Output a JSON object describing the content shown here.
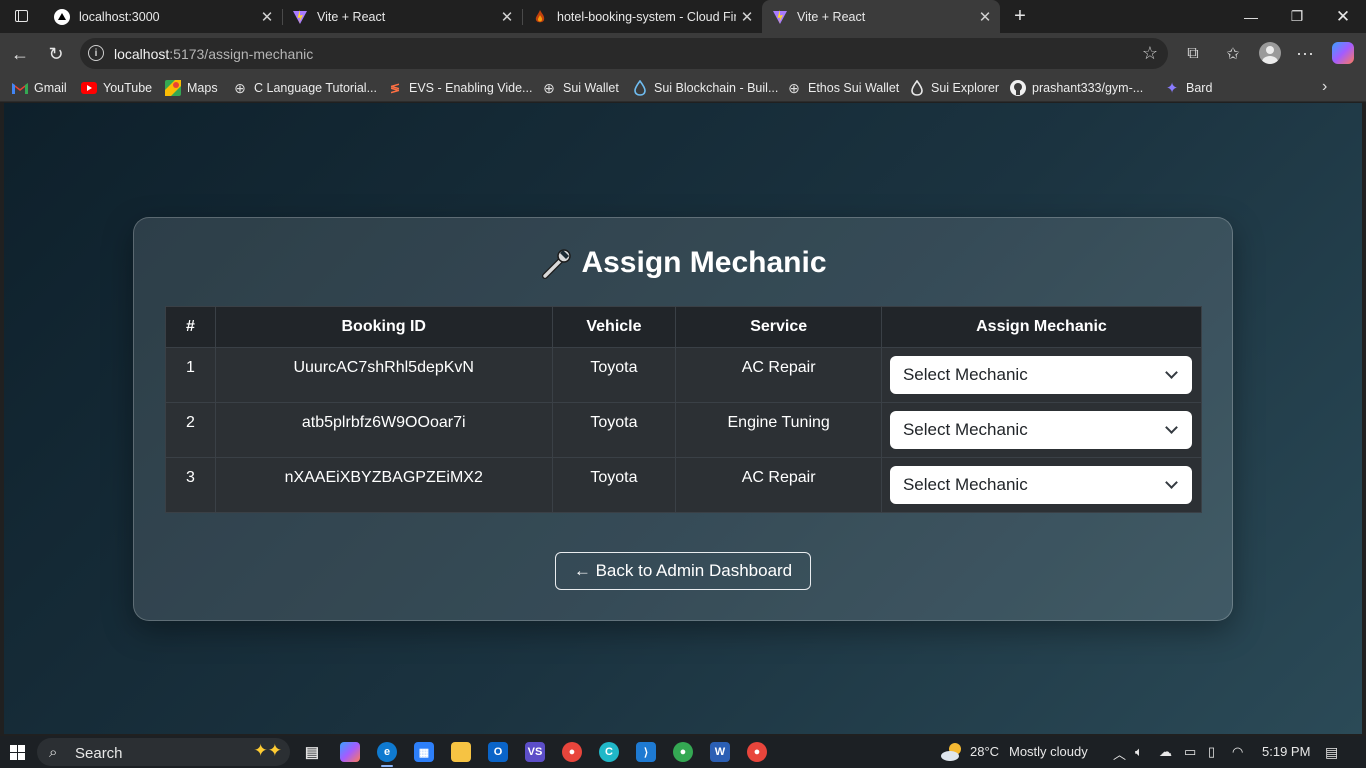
{
  "browser": {
    "tabs": [
      {
        "title": "localhost:3000",
        "active": false
      },
      {
        "title": "Vite + React",
        "active": false
      },
      {
        "title": "hotel-booking-system - Cloud Fir",
        "active": false
      },
      {
        "title": "Vite + React",
        "active": true
      }
    ],
    "address": {
      "host": "localhost",
      "path": ":5173/assign-mechanic"
    },
    "bookmarks": [
      {
        "label": "Gmail",
        "icon": "gmail-icon"
      },
      {
        "label": "YouTube",
        "icon": "youtube-icon"
      },
      {
        "label": "Maps",
        "icon": "maps-icon"
      },
      {
        "label": "C Language Tutorial...",
        "icon": "globe-icon"
      },
      {
        "label": "EVS - Enabling Vide...",
        "icon": "evs-icon"
      },
      {
        "label": "Sui Wallet",
        "icon": "globe-icon"
      },
      {
        "label": "Sui Blockchain - Buil...",
        "icon": "sui-drop-icon"
      },
      {
        "label": "Ethos Sui Wallet",
        "icon": "globe-icon"
      },
      {
        "label": "Sui Explorer",
        "icon": "sui-drop-icon"
      },
      {
        "label": "prashant333/gym-...",
        "icon": "github-icon"
      },
      {
        "label": "Bard",
        "icon": "bard-icon"
      }
    ]
  },
  "page": {
    "title": "Assign Mechanic",
    "title_icon": "wrench-icon",
    "table": {
      "headers": [
        "#",
        "Booking ID",
        "Vehicle",
        "Service",
        "Assign Mechanic"
      ],
      "rows": [
        {
          "index": "1",
          "booking_id": "UuurcAC7shRhl5depKvN",
          "vehicle": "Toyota",
          "service": "AC Repair",
          "mechanic": "Select Mechanic"
        },
        {
          "index": "2",
          "booking_id": "atb5plrbfz6W9OOoar7i",
          "vehicle": "Toyota",
          "service": "Engine Tuning",
          "mechanic": "Select Mechanic"
        },
        {
          "index": "3",
          "booking_id": "nXAAEiXBYZBAGPZEiMX2",
          "vehicle": "Toyota",
          "service": "AC Repair",
          "mechanic": "Select Mechanic"
        }
      ]
    },
    "back_button": "← Back to Admin Dashboard"
  },
  "taskbar": {
    "search_placeholder": "Search",
    "temperature": "28°C",
    "weather": "Mostly cloudy",
    "time": "5:19 PM"
  },
  "colors": {
    "page_gradient_start": "#0e202b",
    "page_gradient_end": "#2b4a57",
    "table_header": "#212529",
    "table_cell": "#2c3034"
  }
}
